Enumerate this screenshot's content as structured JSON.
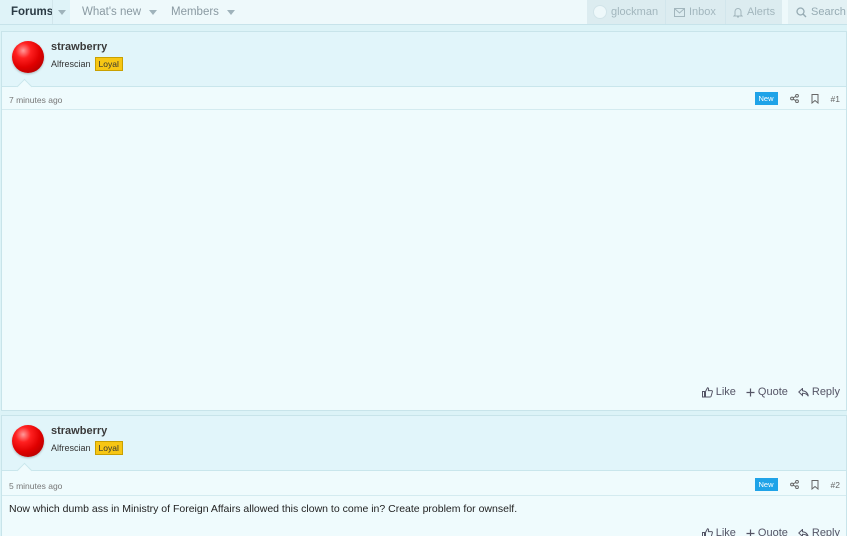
{
  "nav": {
    "forums": "Forums",
    "whats_new": "What's new",
    "members": "Members",
    "username": "glockman",
    "inbox": "Inbox",
    "alerts": "Alerts",
    "search": "Search"
  },
  "posts": [
    {
      "username": "strawberry",
      "user_title": "Alfrescian",
      "badge": "Loyal",
      "time": "7 minutes ago",
      "new_label": "New",
      "number": "#1",
      "message": "",
      "actions": {
        "like": "Like",
        "quote": "Quote",
        "reply": "Reply"
      }
    },
    {
      "username": "strawberry",
      "user_title": "Alfrescian",
      "badge": "Loyal",
      "time": "5 minutes ago",
      "new_label": "New",
      "number": "#2",
      "message": "Now which dumb ass in Ministry of Foreign Affairs allowed this clown to come in? Create problem for ownself.",
      "actions": {
        "like": "Like",
        "quote": "Quote",
        "reply": "Reply"
      }
    }
  ],
  "colors": {
    "accent": "#1fa3e8",
    "badge": "#f7c614",
    "avatar": "#e00000"
  }
}
